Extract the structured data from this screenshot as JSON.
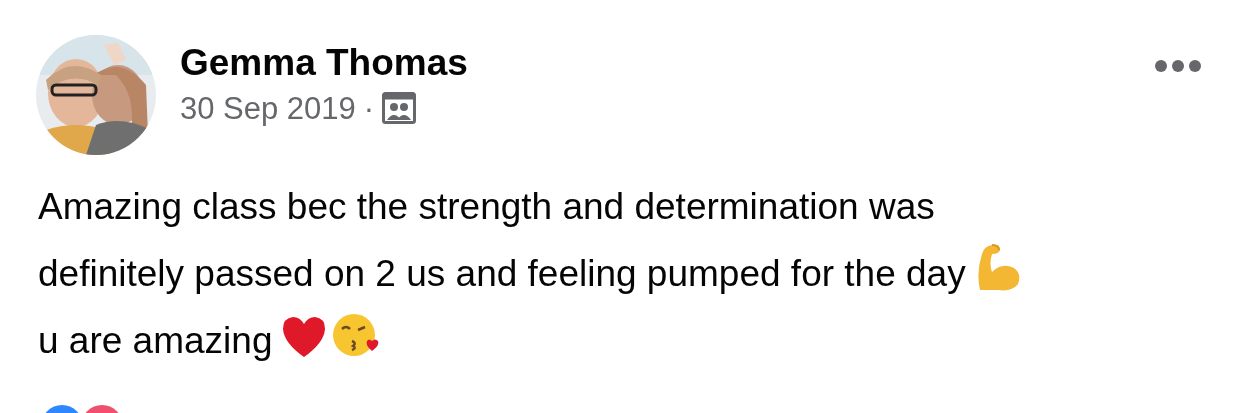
{
  "post": {
    "author": "Gemma Thomas",
    "date": "30 Sep 2019",
    "separator": "·",
    "lines": [
      "Amazing class bec the strength and determination was",
      "definitely passed on 2 us and feeling pumped for the day",
      "u are amazing"
    ]
  }
}
